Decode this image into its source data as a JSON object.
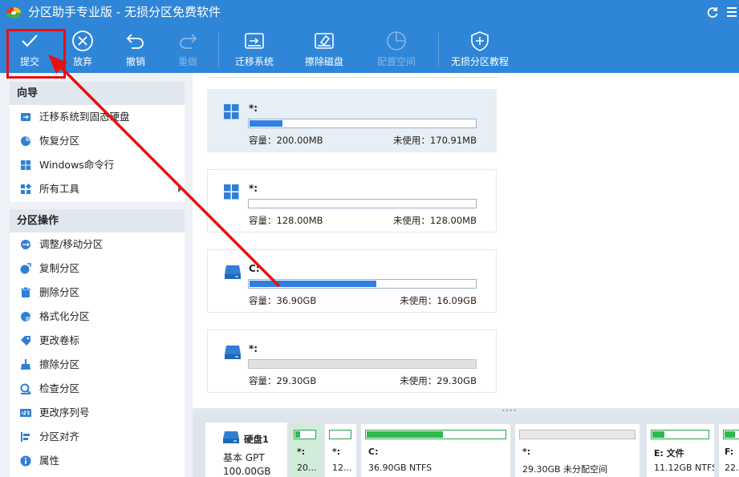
{
  "window": {
    "title": "分区助手专业版 - 无损分区免费软件"
  },
  "toolbar": {
    "commit": "提交",
    "discard": "放弃",
    "undo": "撤销",
    "redo": "重做",
    "migrate": "迁移系统",
    "wipe_disk": "擦除磁盘",
    "allocate_space": "配置空间",
    "tutorial": "无损分区教程"
  },
  "sidebar": {
    "wizard": {
      "header": "向导",
      "items": [
        {
          "label": "迁移系统到固态硬盘",
          "icon": "migrate-ssd-icon"
        },
        {
          "label": "恢复分区",
          "icon": "recover-partition-icon"
        },
        {
          "label": "Windows命令行",
          "icon": "windows-icon"
        },
        {
          "label": "所有工具",
          "icon": "all-tools-icon"
        }
      ]
    },
    "operations": {
      "header": "分区操作",
      "items": [
        {
          "label": "调整/移动分区",
          "icon": "resize-partition-icon"
        },
        {
          "label": "复制分区",
          "icon": "copy-partition-icon"
        },
        {
          "label": "删除分区",
          "icon": "delete-partition-icon"
        },
        {
          "label": "格式化分区",
          "icon": "format-partition-icon"
        },
        {
          "label": "更改卷标",
          "icon": "label-icon"
        },
        {
          "label": "擦除分区",
          "icon": "wipe-partition-icon"
        },
        {
          "label": "检查分区",
          "icon": "check-partition-icon"
        },
        {
          "label": "更改序列号",
          "icon": "serial-number-icon"
        },
        {
          "label": "分区对齐",
          "icon": "align-partition-icon"
        },
        {
          "label": "属性",
          "icon": "info-icon"
        }
      ]
    }
  },
  "partitions": [
    {
      "name": "*:",
      "capacity": "容量：200.00MB",
      "unused": "未使用：170.91MB",
      "used_fraction": 0.146,
      "icon": "windows-icon",
      "selected": true
    },
    {
      "name": "*:",
      "capacity": "容量：128.00MB",
      "unused": "未使用：128.00MB",
      "used_fraction": 0,
      "icon": "windows-icon",
      "selected": false
    },
    {
      "name": "C:",
      "capacity": "容量：36.90GB",
      "unused": "未使用：16.09GB",
      "used_fraction": 0.564,
      "icon": "drive-icon",
      "selected": false
    },
    {
      "name": "*:",
      "capacity": "容量：29.30GB",
      "unused": "未使用：29.30GB",
      "used_fraction": 0,
      "icon": "drive-icon",
      "selected": false,
      "unallocated": true
    }
  ],
  "disk": {
    "name": "硬盘1",
    "type": "基本 GPT",
    "size": "100.00GB",
    "parts": [
      {
        "label": "*:",
        "info": "20...",
        "used_fraction": 0.25,
        "selected": true
      },
      {
        "label": "*:",
        "info": "12...",
        "used_fraction": 0,
        "selected": false
      },
      {
        "label": "C:",
        "info": "36.90GB NTFS",
        "used_fraction": 0.55,
        "selected": false
      },
      {
        "label": "*:",
        "info": "29.30GB 未分配空间",
        "used_fraction": 0,
        "selected": false,
        "unallocated": true
      },
      {
        "label": "E: 文件",
        "info": "11.12GB NTFS",
        "used_fraction": 0.22,
        "selected": false
      },
      {
        "label": "F:",
        "info": "22.",
        "used_fraction": 0.5,
        "selected": false
      }
    ]
  },
  "colors": {
    "title_bar": "#2f86d8",
    "usage_fill": "#2f80e0",
    "disk_fill": "#2eb84e",
    "annotation": "#e81010"
  }
}
